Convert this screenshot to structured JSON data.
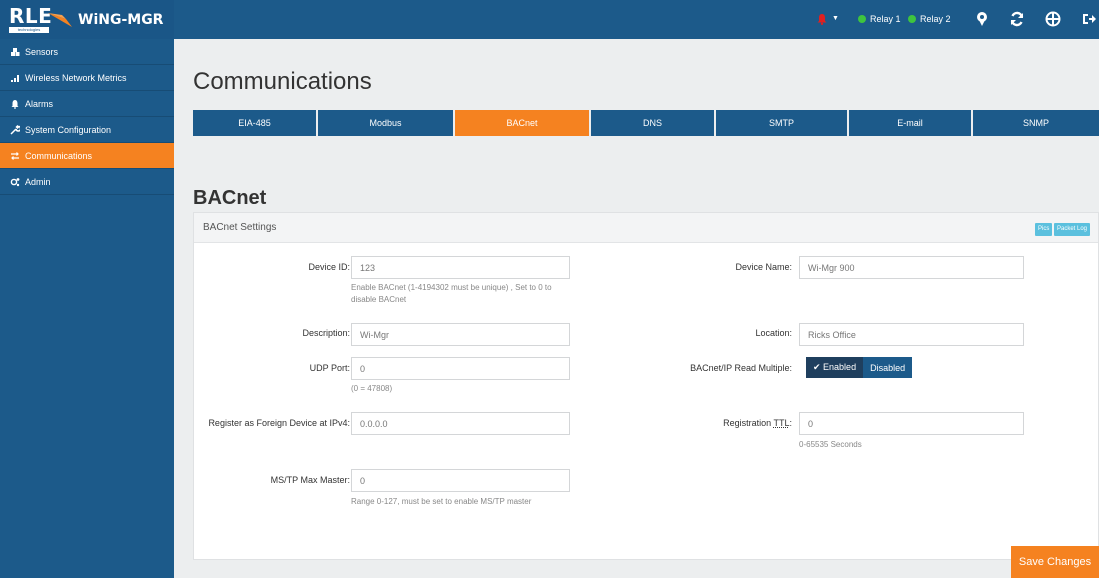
{
  "brand": {
    "logo": "RLE",
    "logo_sub": "technologies",
    "product": "WiNG-MGR"
  },
  "topbar": {
    "alarm_color": "#e02020",
    "relays": [
      {
        "label": "Relay 1",
        "color": "#3ec43e"
      },
      {
        "label": "Relay 2",
        "color": "#3ec43e"
      }
    ],
    "icons": [
      "map-marker-icon",
      "refresh-icon",
      "globe-icon",
      "logout-icon"
    ]
  },
  "sidebar": {
    "items": [
      {
        "label": "Sensors",
        "icon": "cubes-icon"
      },
      {
        "label": "Wireless Network Metrics",
        "icon": "signal-icon"
      },
      {
        "label": "Alarms",
        "icon": "bell-icon"
      },
      {
        "label": "System Configuration",
        "icon": "wrench-icon"
      },
      {
        "label": "Communications",
        "icon": "exchange-icon",
        "active": true
      },
      {
        "label": "Admin",
        "icon": "cogs-icon"
      }
    ]
  },
  "page": {
    "title": "Communications"
  },
  "tabs": [
    {
      "label": "EIA-485"
    },
    {
      "label": "Modbus"
    },
    {
      "label": "BACnet",
      "active": true
    },
    {
      "label": "DNS"
    },
    {
      "label": "SMTP"
    },
    {
      "label": "E-mail"
    },
    {
      "label": "SNMP"
    }
  ],
  "section": {
    "title": "BACnet"
  },
  "panel": {
    "title": "BACnet Settings",
    "pics_label": "Pics",
    "packet_log_label": "Packet Log"
  },
  "form": {
    "device_id": {
      "label": "Device ID:",
      "value": "123",
      "help": "Enable BACnet (1-4194302 must be unique) , Set to 0 to disable BACnet"
    },
    "device_name": {
      "label": "Device Name:",
      "value": "Wi-Mgr 900"
    },
    "description": {
      "label": "Description:",
      "value": "Wi-Mgr"
    },
    "location": {
      "label": "Location:",
      "value": "Ricks Office"
    },
    "udp_port": {
      "label": "UDP Port:",
      "value": "0",
      "help": "(0 = 47808)"
    },
    "read_multiple": {
      "label": "BACnet/IP Read Multiple:",
      "enabled_label": "✔ Enabled",
      "disabled_label": "Disabled",
      "selected": "Enabled"
    },
    "foreign_device": {
      "label": "Register as Foreign Device at IPv4:",
      "value": "0.0.0.0"
    },
    "registration_ttl": {
      "label_prefix": "Registration ",
      "label_ttl": "TTL",
      "label_suffix": ":",
      "value": "0",
      "help": "0-65535 Seconds"
    },
    "mstp_max_master": {
      "label": "MS/TP Max Master:",
      "value": "0",
      "help": "Range 0-127, must be set to enable MS/TP master"
    }
  },
  "actions": {
    "save_label": "Save Changes"
  },
  "colors": {
    "nav_blue": "#1c5a8a",
    "accent_orange": "#f58220",
    "relay_green": "#3ec43e",
    "info_blue": "#5bc0de"
  }
}
